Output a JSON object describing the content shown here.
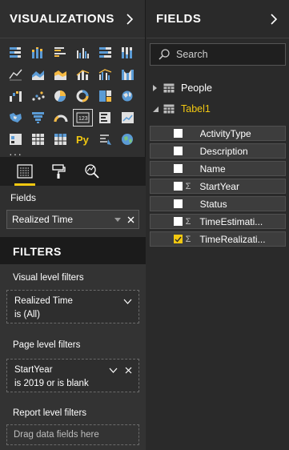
{
  "visualizations": {
    "title": "VISUALIZATIONS",
    "more_label": "···",
    "tabs": [
      "fields-tab",
      "format-tab",
      "analytics-tab"
    ]
  },
  "fields_well": {
    "label": "Fields",
    "value": "Realized Time"
  },
  "filters": {
    "title": "FILTERS",
    "visual_level_label": "Visual level filters",
    "visual_filter": {
      "field": "Realized Time",
      "condition": "is (All)"
    },
    "page_level_label": "Page level filters",
    "page_filter": {
      "field": "StartYear",
      "condition": "is 2019 or is blank"
    },
    "report_level_label": "Report level filters",
    "drop_placeholder": "Drag data fields here"
  },
  "fields_pane": {
    "title": "FIELDS",
    "search_placeholder": "Search",
    "tables": [
      {
        "name": "People",
        "expanded": false,
        "highlighted": false
      },
      {
        "name": "Tabel1",
        "expanded": true,
        "highlighted": true
      }
    ],
    "items": [
      {
        "name": "ActivityType",
        "sigma": false,
        "checked": false
      },
      {
        "name": "Description",
        "sigma": false,
        "checked": false
      },
      {
        "name": "Name",
        "sigma": false,
        "checked": false
      },
      {
        "name": "StartYear",
        "sigma": true,
        "checked": false
      },
      {
        "name": "Status",
        "sigma": false,
        "checked": false
      },
      {
        "name": "TimeEstimati...",
        "sigma": true,
        "checked": false
      },
      {
        "name": "TimeRealizati...",
        "sigma": true,
        "checked": true
      }
    ]
  },
  "colors": {
    "accent_yellow": "#f2c811",
    "pane_bg": "#2f2f2f",
    "header_bg": "#1b1b1b"
  }
}
